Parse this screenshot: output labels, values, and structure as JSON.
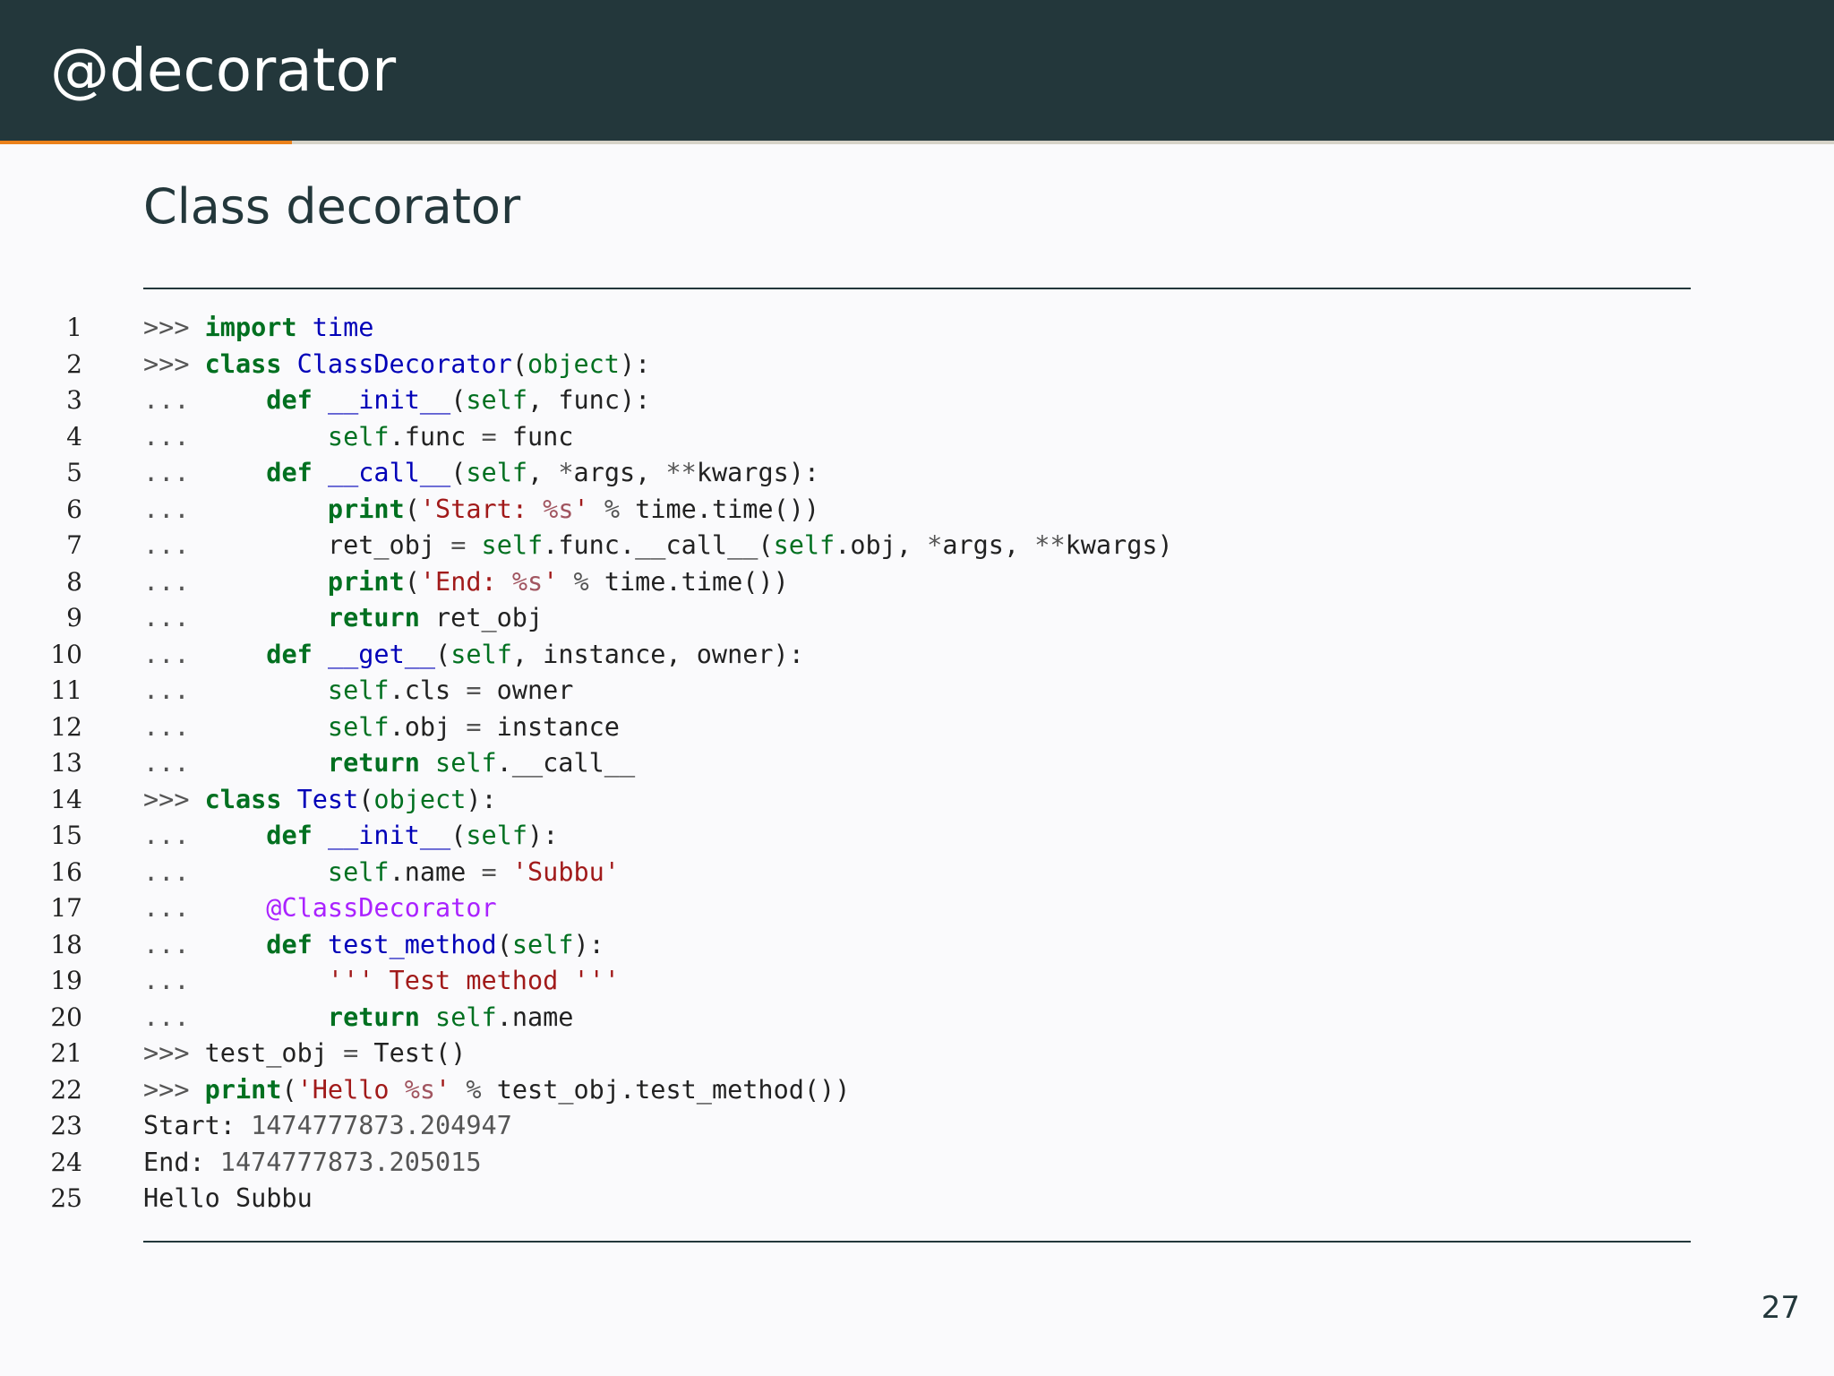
{
  "slide": {
    "title": "@decorator",
    "subtitle": "Class decorator",
    "page_number": "27",
    "progress_fraction": 0.159
  },
  "colors": {
    "header_bg": "#23373b",
    "accent": "#eb811b",
    "progress_track": "#d6d3c8",
    "background": "#fafafc",
    "keyword": "#007020",
    "name": "#0000b8",
    "string": "#a11a1a",
    "interpolation": "#a15560",
    "decorator": "#aa22ff",
    "prompt": "#555555"
  },
  "code": {
    "lines": [
      {
        "n": "1",
        "tokens": [
          {
            "t": ">>> ",
            "k": "p"
          },
          {
            "t": "import",
            "k": "k"
          },
          {
            "t": " "
          },
          {
            "t": "time",
            "k": "n"
          }
        ]
      },
      {
        "n": "2",
        "tokens": [
          {
            "t": ">>> ",
            "k": "p"
          },
          {
            "t": "class",
            "k": "k"
          },
          {
            "t": " "
          },
          {
            "t": "ClassDecorator",
            "k": "n"
          },
          {
            "t": "("
          },
          {
            "t": "object",
            "k": "b"
          },
          {
            "t": "):"
          }
        ]
      },
      {
        "n": "3",
        "tokens": [
          {
            "t": "...     ",
            "k": "p"
          },
          {
            "t": "def",
            "k": "k"
          },
          {
            "t": " "
          },
          {
            "t": "__init__",
            "k": "n"
          },
          {
            "t": "("
          },
          {
            "t": "self",
            "k": "b"
          },
          {
            "t": ", func):"
          }
        ]
      },
      {
        "n": "4",
        "tokens": [
          {
            "t": "...         ",
            "k": "p"
          },
          {
            "t": "self",
            "k": "b"
          },
          {
            "t": ".func "
          },
          {
            "t": "=",
            "k": "o"
          },
          {
            "t": " func"
          }
        ]
      },
      {
        "n": "5",
        "tokens": [
          {
            "t": "...     ",
            "k": "p"
          },
          {
            "t": "def",
            "k": "k"
          },
          {
            "t": " "
          },
          {
            "t": "__call__",
            "k": "n"
          },
          {
            "t": "("
          },
          {
            "t": "self",
            "k": "b"
          },
          {
            "t": ", "
          },
          {
            "t": "*",
            "k": "o"
          },
          {
            "t": "args, "
          },
          {
            "t": "**",
            "k": "o"
          },
          {
            "t": "kwargs):"
          }
        ]
      },
      {
        "n": "6",
        "tokens": [
          {
            "t": "...         ",
            "k": "p"
          },
          {
            "t": "print",
            "k": "k"
          },
          {
            "t": "("
          },
          {
            "t": "'Start: ",
            "k": "s"
          },
          {
            "t": "%s",
            "k": "i"
          },
          {
            "t": "'",
            "k": "s"
          },
          {
            "t": " "
          },
          {
            "t": "%",
            "k": "o"
          },
          {
            "t": " time.time())"
          }
        ]
      },
      {
        "n": "7",
        "tokens": [
          {
            "t": "...         ",
            "k": "p"
          },
          {
            "t": "ret_obj "
          },
          {
            "t": "=",
            "k": "o"
          },
          {
            "t": " "
          },
          {
            "t": "self",
            "k": "b"
          },
          {
            "t": ".func.__call__("
          },
          {
            "t": "self",
            "k": "b"
          },
          {
            "t": ".obj, "
          },
          {
            "t": "*",
            "k": "o"
          },
          {
            "t": "args, "
          },
          {
            "t": "**",
            "k": "o"
          },
          {
            "t": "kwargs)"
          }
        ]
      },
      {
        "n": "8",
        "tokens": [
          {
            "t": "...         ",
            "k": "p"
          },
          {
            "t": "print",
            "k": "k"
          },
          {
            "t": "("
          },
          {
            "t": "'End: ",
            "k": "s"
          },
          {
            "t": "%s",
            "k": "i"
          },
          {
            "t": "'",
            "k": "s"
          },
          {
            "t": " "
          },
          {
            "t": "%",
            "k": "o"
          },
          {
            "t": " time.time())"
          }
        ]
      },
      {
        "n": "9",
        "tokens": [
          {
            "t": "...         ",
            "k": "p"
          },
          {
            "t": "return",
            "k": "k"
          },
          {
            "t": " ret_obj"
          }
        ]
      },
      {
        "n": "10",
        "tokens": [
          {
            "t": "...     ",
            "k": "p"
          },
          {
            "t": "def",
            "k": "k"
          },
          {
            "t": " "
          },
          {
            "t": "__get__",
            "k": "n"
          },
          {
            "t": "("
          },
          {
            "t": "self",
            "k": "b"
          },
          {
            "t": ", instance, owner):"
          }
        ]
      },
      {
        "n": "11",
        "tokens": [
          {
            "t": "...         ",
            "k": "p"
          },
          {
            "t": "self",
            "k": "b"
          },
          {
            "t": ".cls "
          },
          {
            "t": "=",
            "k": "o"
          },
          {
            "t": " owner"
          }
        ]
      },
      {
        "n": "12",
        "tokens": [
          {
            "t": "...         ",
            "k": "p"
          },
          {
            "t": "self",
            "k": "b"
          },
          {
            "t": ".obj "
          },
          {
            "t": "=",
            "k": "o"
          },
          {
            "t": " instance"
          }
        ]
      },
      {
        "n": "13",
        "tokens": [
          {
            "t": "...         ",
            "k": "p"
          },
          {
            "t": "return",
            "k": "k"
          },
          {
            "t": " "
          },
          {
            "t": "self",
            "k": "b"
          },
          {
            "t": ".__call__"
          }
        ]
      },
      {
        "n": "14",
        "tokens": [
          {
            "t": ">>> ",
            "k": "p"
          },
          {
            "t": "class",
            "k": "k"
          },
          {
            "t": " "
          },
          {
            "t": "Test",
            "k": "n"
          },
          {
            "t": "("
          },
          {
            "t": "object",
            "k": "b"
          },
          {
            "t": "):"
          }
        ]
      },
      {
        "n": "15",
        "tokens": [
          {
            "t": "...     ",
            "k": "p"
          },
          {
            "t": "def",
            "k": "k"
          },
          {
            "t": " "
          },
          {
            "t": "__init__",
            "k": "n"
          },
          {
            "t": "("
          },
          {
            "t": "self",
            "k": "b"
          },
          {
            "t": "):"
          }
        ]
      },
      {
        "n": "16",
        "tokens": [
          {
            "t": "...         ",
            "k": "p"
          },
          {
            "t": "self",
            "k": "b"
          },
          {
            "t": ".name "
          },
          {
            "t": "=",
            "k": "o"
          },
          {
            "t": " "
          },
          {
            "t": "'Subbu'",
            "k": "s"
          }
        ]
      },
      {
        "n": "17",
        "tokens": [
          {
            "t": "...     ",
            "k": "p"
          },
          {
            "t": "@ClassDecorator",
            "k": "d"
          }
        ]
      },
      {
        "n": "18",
        "tokens": [
          {
            "t": "...     ",
            "k": "p"
          },
          {
            "t": "def",
            "k": "k"
          },
          {
            "t": " "
          },
          {
            "t": "test_method",
            "k": "n"
          },
          {
            "t": "("
          },
          {
            "t": "self",
            "k": "b"
          },
          {
            "t": "):"
          }
        ]
      },
      {
        "n": "19",
        "tokens": [
          {
            "t": "...         ",
            "k": "p"
          },
          {
            "t": "''' Test method '''",
            "k": "s"
          }
        ]
      },
      {
        "n": "20",
        "tokens": [
          {
            "t": "...         ",
            "k": "p"
          },
          {
            "t": "return",
            "k": "k"
          },
          {
            "t": " "
          },
          {
            "t": "self",
            "k": "b"
          },
          {
            "t": ".name"
          }
        ]
      },
      {
        "n": "21",
        "tokens": [
          {
            "t": ">>> ",
            "k": "p"
          },
          {
            "t": "test_obj "
          },
          {
            "t": "=",
            "k": "o"
          },
          {
            "t": " Test()"
          }
        ]
      },
      {
        "n": "22",
        "tokens": [
          {
            "t": ">>> ",
            "k": "p"
          },
          {
            "t": "print",
            "k": "k"
          },
          {
            "t": "("
          },
          {
            "t": "'Hello ",
            "k": "s"
          },
          {
            "t": "%s",
            "k": "i"
          },
          {
            "t": "'",
            "k": "s"
          },
          {
            "t": " "
          },
          {
            "t": "%",
            "k": "o"
          },
          {
            "t": " test_obj.test_method())"
          }
        ]
      },
      {
        "n": "23",
        "tokens": [
          {
            "t": "Start: "
          },
          {
            "t": "1474777873.204947",
            "k": "o"
          }
        ]
      },
      {
        "n": "24",
        "tokens": [
          {
            "t": "End: "
          },
          {
            "t": "1474777873.205015",
            "k": "o"
          }
        ]
      },
      {
        "n": "25",
        "tokens": [
          {
            "t": "Hello Subbu"
          }
        ]
      }
    ]
  }
}
